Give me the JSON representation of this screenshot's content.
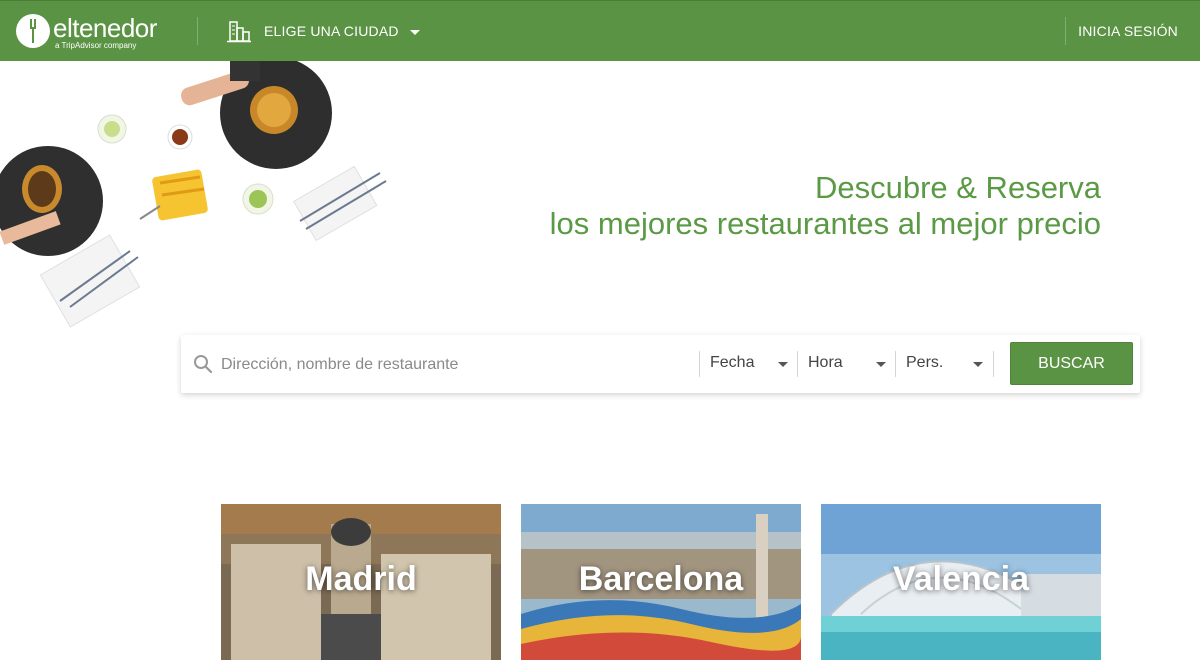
{
  "header": {
    "logo_text": "eltenedor",
    "logo_subtitle": "a TripAdvisor company",
    "city_select_label": "ELIGE UNA CIUDAD",
    "login_label": "INICIA SESIÓN",
    "brand_color": "#5a9344"
  },
  "hero": {
    "headline_line1": "Descubre & Reserva",
    "headline_line2": "los mejores restaurantes al mejor precio",
    "headline_color": "#5b9a45"
  },
  "search": {
    "placeholder": "Dirección, nombre de restaurante",
    "date_label": "Fecha",
    "time_label": "Hora",
    "people_label": "Pers.",
    "button_label": "BUSCAR"
  },
  "cities": [
    {
      "name": "Madrid"
    },
    {
      "name": "Barcelona"
    },
    {
      "name": "Valencia"
    }
  ]
}
